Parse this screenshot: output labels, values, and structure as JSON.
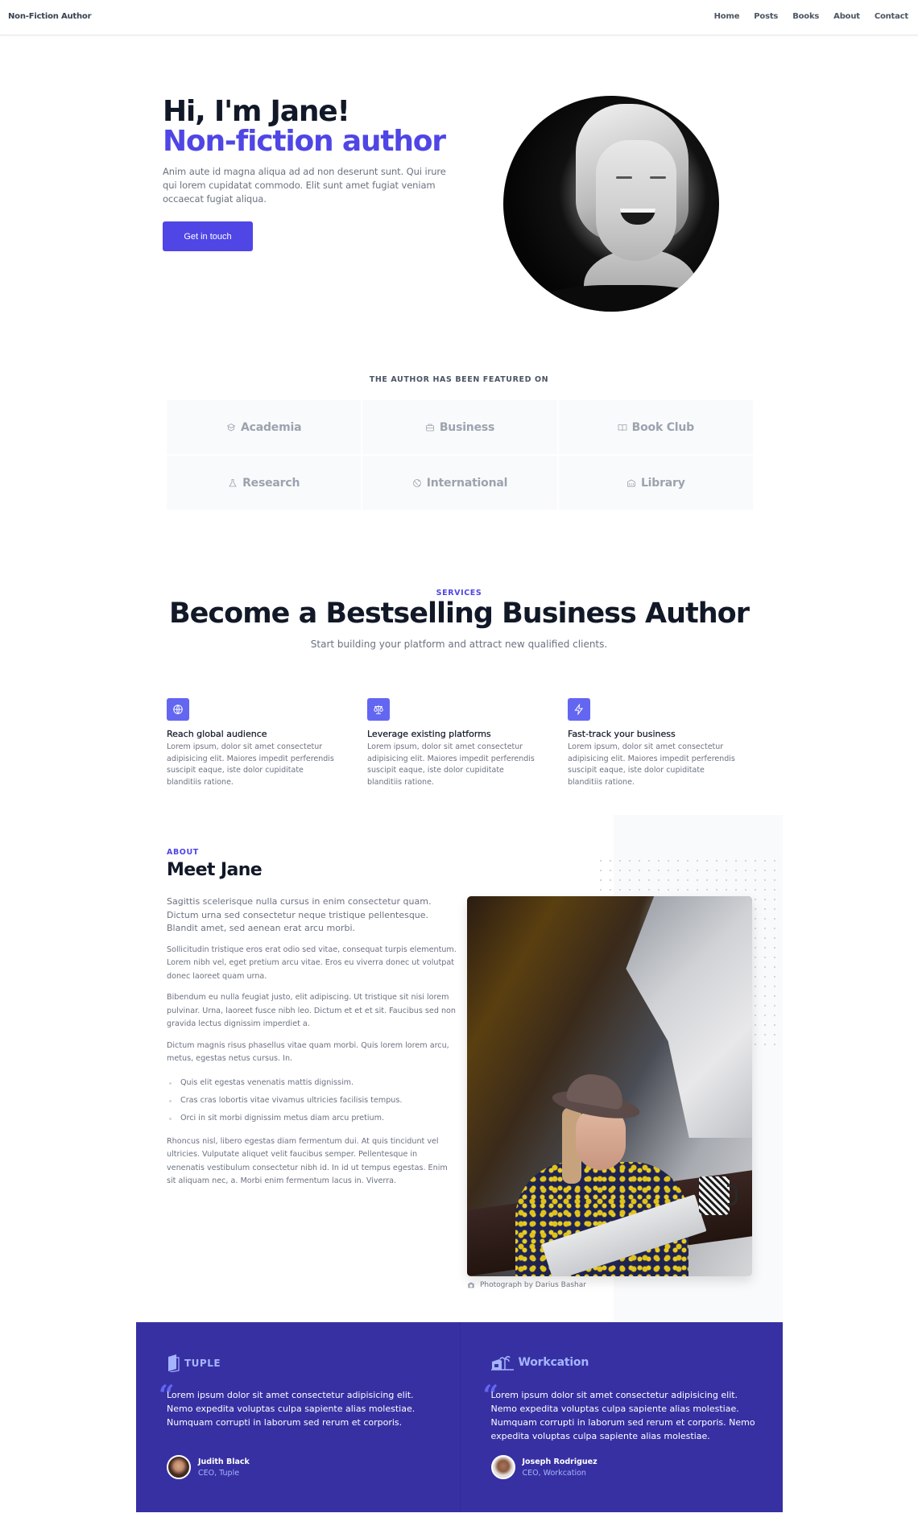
{
  "nav": {
    "brand": "Non-Fiction Author",
    "links": [
      "Home",
      "Posts",
      "Books",
      "About",
      "Contact"
    ]
  },
  "hero": {
    "title_line1": "Hi, I'm Jane!",
    "title_line2": "Non-fiction author",
    "text": "Anim aute id magna aliqua ad ad non deserunt sunt. Qui irure qui lorem cupidatat commodo. Elit sunt amet fugiat veniam occaecat fugiat aliqua.",
    "cta_label": "Get in touch",
    "accent_color": "#4f46e5"
  },
  "featured": {
    "label": "THE AUTHOR HAS BEEN FEATURED ON",
    "items": [
      {
        "label": "Academia",
        "icon": "academic-cap-icon"
      },
      {
        "label": "Business",
        "icon": "briefcase-icon"
      },
      {
        "label": "Book Club",
        "icon": "book-open-icon"
      },
      {
        "label": "Research",
        "icon": "beaker-icon"
      },
      {
        "label": "International",
        "icon": "globe-icon"
      },
      {
        "label": "Library",
        "icon": "library-icon"
      }
    ]
  },
  "services": {
    "label": "SERVICES",
    "title": "Become a Bestselling Business Author",
    "subtitle": "Start building your platform and attract new qualified clients.",
    "features": [
      {
        "title": "Reach global audience",
        "icon": "globe-icon",
        "text": "Lorem ipsum, dolor sit amet consectetur adipisicing elit. Maiores impedit perferendis suscipit eaque, iste dolor cupiditate blanditiis ratione."
      },
      {
        "title": "Leverage existing platforms",
        "icon": "scale-icon",
        "text": "Lorem ipsum, dolor sit amet consectetur adipisicing elit. Maiores impedit perferendis suscipit eaque, iste dolor cupiditate blanditiis ratione."
      },
      {
        "title": "Fast-track your business",
        "icon": "lightning-bolt-icon",
        "text": "Lorem ipsum, dolor sit amet consectetur adipisicing elit. Maiores impedit perferendis suscipit eaque, iste dolor cupiditate blanditiis ratione."
      }
    ]
  },
  "about": {
    "label": "ABOUT",
    "title": "Meet Jane",
    "lead": "Sagittis scelerisque nulla cursus in enim consectetur quam. Dictum urna sed consectetur neque tristique pellentesque. Blandit amet, sed aenean erat arcu morbi.",
    "paragraphs": [
      "Sollicitudin tristique eros erat odio sed vitae, consequat turpis elementum. Lorem nibh vel, eget pretium arcu vitae. Eros eu viverra donec ut volutpat donec laoreet quam urna.",
      "Bibendum eu nulla feugiat justo, elit adipiscing. Ut tristique sit nisi lorem pulvinar. Urna, laoreet fusce nibh leo. Dictum et et et sit. Faucibus sed non gravida lectus dignissim imperdiet a.",
      "Dictum magnis risus phasellus vitae quam morbi. Quis lorem lorem arcu, metus, egestas netus cursus. In."
    ],
    "bullets": [
      "Quis elit egestas venenatis mattis dignissim.",
      "Cras cras lobortis vitae vivamus ultricies facilisis tempus.",
      "Orci in sit morbi dignissim metus diam arcu pretium."
    ],
    "closing": "Rhoncus nisl, libero egestas diam fermentum dui. At quis tincidunt vel ultricies. Vulputate aliquet velit faucibus semper. Pellentesque in venenatis vestibulum consectetur nibh id. In id ut tempus egestas. Enim sit aliquam nec, a. Morbi enim fermentum lacus in. Viverra.",
    "photo_caption": "Photograph by Darius Bashar"
  },
  "testimonials": {
    "background_color": "#3730a3",
    "items": [
      {
        "company": "TUPLE",
        "quote": "Lorem ipsum dolor sit amet consectetur adipisicing elit. Nemo expedita voluptas culpa sapiente alias molestiae. Numquam corrupti in laborum sed rerum et corporis.",
        "name": "Judith Black",
        "role": "CEO, Tuple"
      },
      {
        "company": "Workcation",
        "quote": "Lorem ipsum dolor sit amet consectetur adipisicing elit. Nemo expedita voluptas culpa sapiente alias molestiae. Numquam corrupti in laborum sed rerum et corporis. Nemo expedita voluptas culpa sapiente alias molestiae.",
        "name": "Joseph Rodriguez",
        "role": "CEO, Workcation"
      }
    ]
  }
}
